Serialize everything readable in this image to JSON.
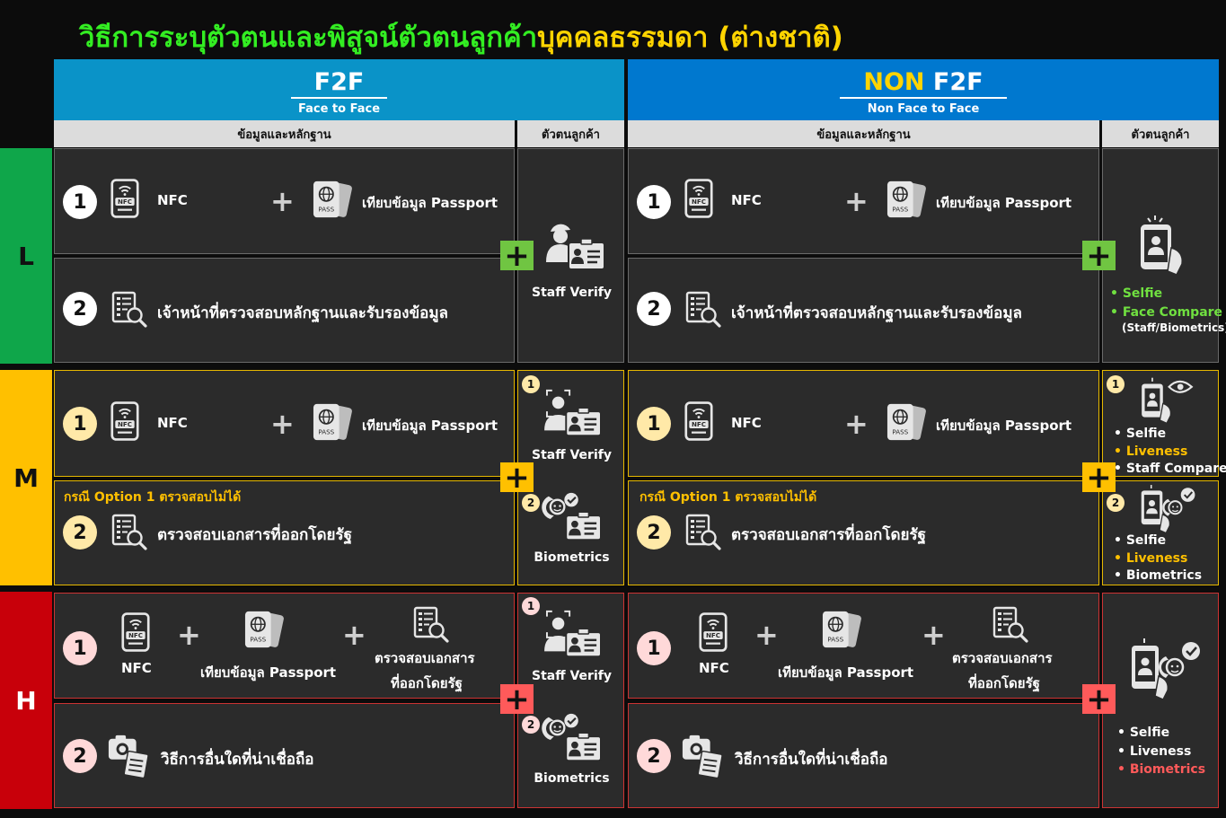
{
  "title": {
    "part1": "วิธีการระบุตัวตนและพิสูจน์ตัวตนลูกค้า",
    "part2": "บุคคลธรรมดา (ต่างชาติ)"
  },
  "f2f": {
    "title": "F2F",
    "subtitle": "Face to Face"
  },
  "nonf2f": {
    "title_prefix": "NON",
    "title_suffix": " F2F",
    "subtitle": "Non Face to Face"
  },
  "subheaders": {
    "evidence": "ข้อมูลและหลักฐาน",
    "identity": "ตัวตนลูกค้า"
  },
  "levels": {
    "l": "L",
    "m": "M",
    "h": "H"
  },
  "common": {
    "nfc": "NFC",
    "passport_check": "เทียบข้อมูล Passport",
    "pass": "PASS",
    "plus": "+",
    "n1": "1",
    "n2": "2",
    "staff_verify": "Staff Verify",
    "biometrics": "Biometrics",
    "officer_check": "เจ้าหน้าที่ตรวจสอบหลักฐานและรับรองข้อมูล",
    "option_fail": "กรณี Option 1 ตรวจสอบไม่ได้",
    "gov_doc": "ตรวจสอบเอกสารที่ออกโดยรัฐ",
    "gov_doc_l1": "ตรวจสอบเอกสาร",
    "gov_doc_l2": "ที่ออกโดยรัฐ",
    "other_method": "วิธีการอื่นใดที่น่าเชื่อถือ"
  },
  "non_l_identity": {
    "b1": "Selfie",
    "b2": "Face Compare",
    "b3": "(Staff/Biometrics)"
  },
  "non_m_identity": {
    "opt1": {
      "b1": "Selfie",
      "b2": "Liveness",
      "b3": "Staff Compare"
    },
    "opt2": {
      "b1": "Selfie",
      "b2": "Liveness",
      "b3": "Biometrics"
    }
  },
  "non_h_identity": {
    "b1": "Selfie",
    "b2": "Liveness",
    "b3": "Biometrics"
  },
  "colors": {
    "green": "#0fa64a",
    "yellow": "#ffc000",
    "red": "#c8000a",
    "f2f_blue": "#0a93c8",
    "non_blue": "#0078cf"
  }
}
